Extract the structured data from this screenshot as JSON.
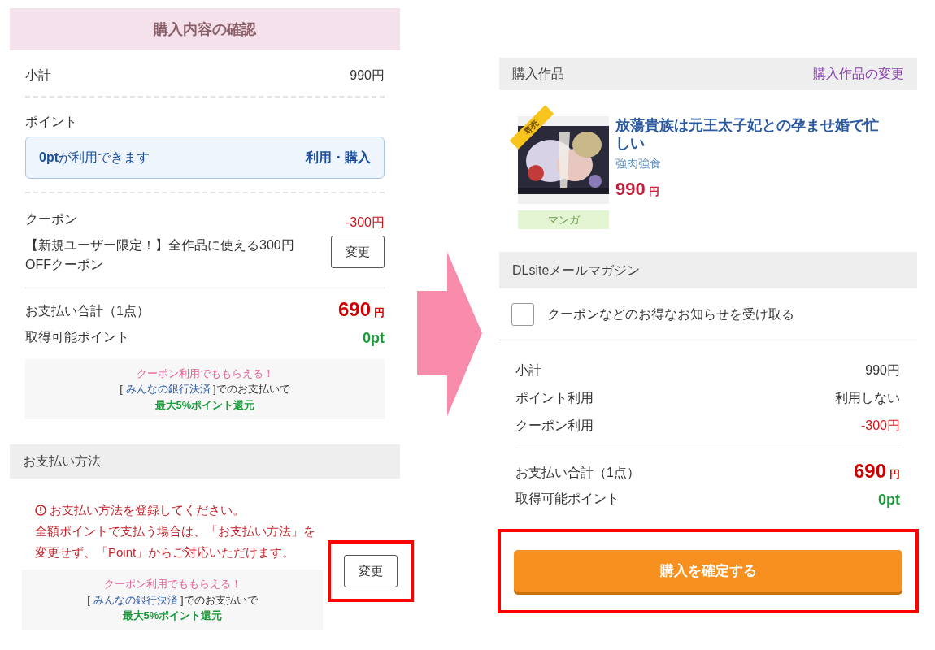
{
  "left_panel": {
    "title": "購入内容の確認",
    "subtotal": {
      "label": "小計",
      "value": "990円"
    },
    "points": {
      "label": "ポイント",
      "message": "**0pt**が利用できます",
      "action": "利用・購入"
    },
    "coupon": {
      "label": "クーポン",
      "discount": "-300円",
      "description": "【新規ユーザー限定！】全作品に使える300円OFFクーポン",
      "button": {
        "label": "変更",
        "highlighted": false
      }
    },
    "total": {
      "label": "お支払い合計（1点）",
      "amount": "690",
      "unit": "円"
    },
    "earnable_points": {
      "label": "取得可能ポイント",
      "value": "0pt"
    },
    "promo": {
      "headline": "クーポン利用でももらえる！",
      "before": "[ ",
      "link": "みんなの銀行決済",
      "after": " ]でのお支払いで",
      "reward": "最大5%ポイント還元"
    },
    "payment": {
      "header": "お支払い方法",
      "error": "お支払い方法を登録してください。",
      "note": "全額ポイントで支払う場合は、「お支払い方法」を変更せず、「Point」からご対応いただけます。",
      "button": {
        "label": "変更",
        "highlighted": true
      },
      "promo": {
        "headline": "クーポン利用でももらえる！",
        "before": "[ ",
        "link": "みんなの銀行決済",
        "after": " ]でのお支払いで",
        "reward": "最大5%ポイント還元"
      }
    }
  },
  "right_panel": {
    "product_section": {
      "header": "購入作品",
      "change_link": "購入作品の変更",
      "item": {
        "badge": "専売",
        "title": "放蕩貴族は元王太子妃との孕ませ婚で忙しい",
        "author": "強肉強食",
        "price": "990",
        "unit": "円",
        "category": "マンガ"
      }
    },
    "newsletter": {
      "header": "DLsiteメールマガジン",
      "checkbox": {
        "label": "クーポンなどのお得なお知らせを受け取る",
        "checked": false
      }
    },
    "summary": {
      "rows": [
        {
          "label": "小計",
          "value": "990円",
          "kind": "plain"
        },
        {
          "label": "ポイント利用",
          "value": "利用しない",
          "kind": "plain"
        },
        {
          "label": "クーポン利用",
          "value": "-300円",
          "kind": "discount"
        }
      ],
      "total": {
        "label": "お支払い合計（1点）",
        "amount": "690",
        "unit": "円"
      },
      "earnable_points": {
        "label": "取得可能ポイント",
        "value": "0pt"
      }
    },
    "confirm_button": {
      "label": "購入を確定する",
      "highlighted": true
    }
  }
}
